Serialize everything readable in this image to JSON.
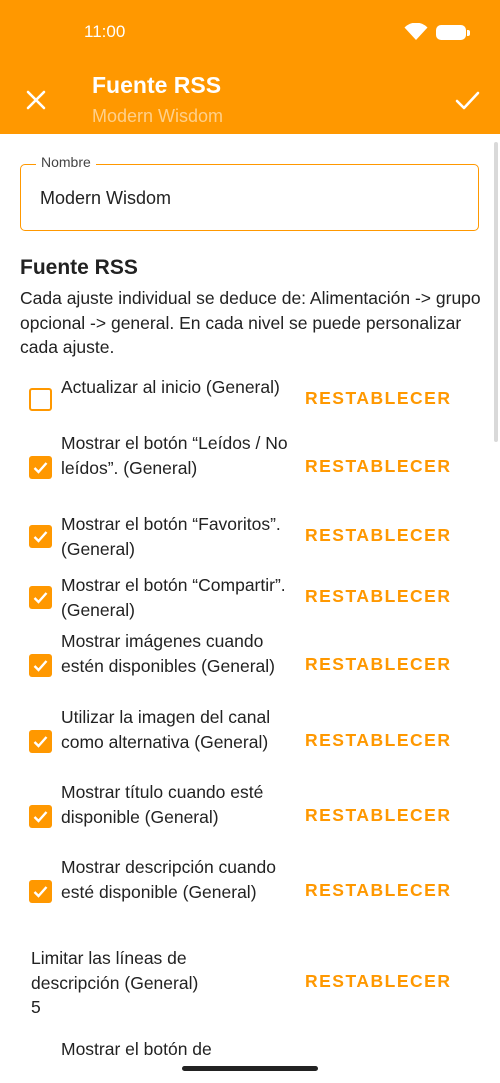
{
  "status": {
    "time": "11:00"
  },
  "appbar": {
    "title": "Fuente RSS",
    "subtitle": "Modern Wisdom"
  },
  "form": {
    "name_label": "Nombre",
    "name_value": "Modern Wisdom"
  },
  "section": {
    "title": "Fuente RSS",
    "description": "Cada ajuste individual se deduce de: Alimentación -> grupo opcional -> general. En cada nivel se puede personalizar cada ajuste."
  },
  "reset_label": "RESTABLECER",
  "settings": [
    {
      "label": "Actualizar al inicio (General)",
      "checked": false
    },
    {
      "label": "Mostrar el botón “Leídos / No leídos”. (General)",
      "checked": true
    },
    {
      "label": "Mostrar el botón “Favoritos”. (General)",
      "checked": true
    },
    {
      "label": "Mostrar el botón “Compartir”. (General)",
      "checked": true
    },
    {
      "label": "Mostrar imágenes cuando estén disponibles (General)",
      "checked": true
    },
    {
      "label": "Utilizar la imagen del canal como alternativa (General)",
      "checked": true
    },
    {
      "label": "Mostrar título cuando esté disponible (General)",
      "checked": true
    },
    {
      "label": "Mostrar descripción cuando esté disponible (General)",
      "checked": true
    }
  ],
  "line_limit": {
    "label": "Limitar las líneas de descripción (General)",
    "value": "5"
  },
  "partial_item": {
    "label": "Mostrar el botón de"
  },
  "colors": {
    "accent": "#FF9800",
    "text": "#222222"
  }
}
